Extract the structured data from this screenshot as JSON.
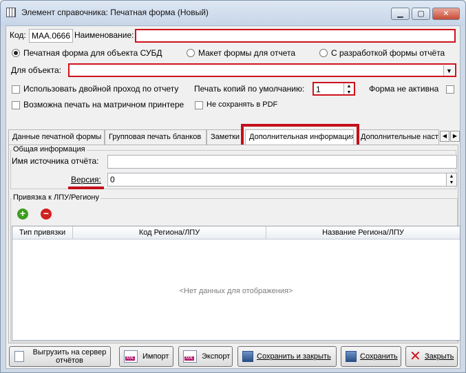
{
  "window": {
    "title": "Элемент справочника: Печатная форма (Новый)",
    "min_glyph": "▁",
    "max_glyph": "▢",
    "close_glyph": "✕"
  },
  "form": {
    "code_label": "Код:",
    "code_value": "МАА.0666",
    "name_label": "Наименование:",
    "name_value": "",
    "radio_options": [
      {
        "label": "Печатная форма для объекта СУБД",
        "selected": true
      },
      {
        "label": "Макет формы для отчета",
        "selected": false
      },
      {
        "label": "С разработкой формы отчёта",
        "selected": false
      }
    ],
    "object_label": "Для объекта:",
    "object_value": "",
    "double_pass_label": "Использовать двойной проход по отчету",
    "copies_label": "Печать копий по умолчанию:",
    "copies_value": "1",
    "inactive_label": "Форма не активна",
    "matrix_print_label": "Возможна печать на матричном принтере",
    "no_pdf_label": "Не сохранять в PDF"
  },
  "tabs": [
    "Данные печатной формы",
    "Групповая печать бланков",
    "Заметки",
    "Дополнительная информация",
    "Дополнительные наст"
  ],
  "tab_arrows": {
    "left": "◀",
    "right": "▶"
  },
  "general_info": {
    "title": "Общая информация",
    "source_label": "Имя источника отчёта:",
    "source_value": "",
    "version_label": "Версия:",
    "version_value": "0"
  },
  "binding": {
    "title": "Привязка к ЛПУ/Региону",
    "add_glyph": "+",
    "remove_glyph": "−",
    "columns": [
      "Тип привязки",
      "Код Региона/ЛПУ",
      "Название Региона/ЛПУ"
    ],
    "empty_text": "<Нет данных для отображения>"
  },
  "buttons": {
    "upload": "Выгрузить на сервер отчётов",
    "import": "Импорт",
    "export": "Экспорт",
    "save_close": "Сохранить и закрыть",
    "save": "Сохранить",
    "close": "Закрыть",
    "xml_tag": "XML"
  },
  "colors": {
    "highlight_red": "#c3101b",
    "add_green": "#3e9d1f",
    "remove_red": "#d12020"
  }
}
